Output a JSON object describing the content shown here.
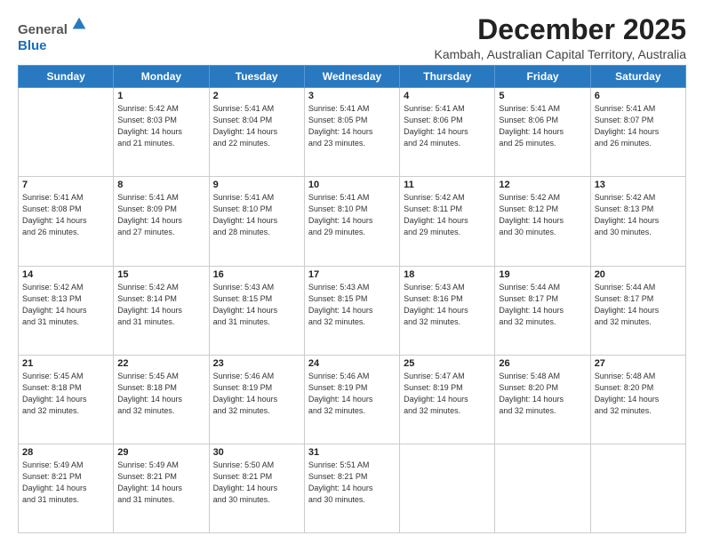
{
  "header": {
    "logo_line1": "General",
    "logo_line2": "Blue",
    "month_title": "December 2025",
    "location": "Kambah, Australian Capital Territory, Australia"
  },
  "days": [
    "Sunday",
    "Monday",
    "Tuesday",
    "Wednesday",
    "Thursday",
    "Friday",
    "Saturday"
  ],
  "weeks": [
    [
      {
        "day": "",
        "empty": true
      },
      {
        "day": "1",
        "sunrise": "5:42 AM",
        "sunset": "8:03 PM",
        "daylight": "14 hours and 21 minutes."
      },
      {
        "day": "2",
        "sunrise": "5:41 AM",
        "sunset": "8:04 PM",
        "daylight": "14 hours and 22 minutes."
      },
      {
        "day": "3",
        "sunrise": "5:41 AM",
        "sunset": "8:05 PM",
        "daylight": "14 hours and 23 minutes."
      },
      {
        "day": "4",
        "sunrise": "5:41 AM",
        "sunset": "8:06 PM",
        "daylight": "14 hours and 24 minutes."
      },
      {
        "day": "5",
        "sunrise": "5:41 AM",
        "sunset": "8:06 PM",
        "daylight": "14 hours and 25 minutes."
      },
      {
        "day": "6",
        "sunrise": "5:41 AM",
        "sunset": "8:07 PM",
        "daylight": "14 hours and 26 minutes."
      }
    ],
    [
      {
        "day": "7",
        "sunrise": "5:41 AM",
        "sunset": "8:08 PM",
        "daylight": "14 hours and 26 minutes."
      },
      {
        "day": "8",
        "sunrise": "5:41 AM",
        "sunset": "8:09 PM",
        "daylight": "14 hours and 27 minutes."
      },
      {
        "day": "9",
        "sunrise": "5:41 AM",
        "sunset": "8:10 PM",
        "daylight": "14 hours and 28 minutes."
      },
      {
        "day": "10",
        "sunrise": "5:41 AM",
        "sunset": "8:10 PM",
        "daylight": "14 hours and 29 minutes."
      },
      {
        "day": "11",
        "sunrise": "5:42 AM",
        "sunset": "8:11 PM",
        "daylight": "14 hours and 29 minutes."
      },
      {
        "day": "12",
        "sunrise": "5:42 AM",
        "sunset": "8:12 PM",
        "daylight": "14 hours and 30 minutes."
      },
      {
        "day": "13",
        "sunrise": "5:42 AM",
        "sunset": "8:13 PM",
        "daylight": "14 hours and 30 minutes."
      }
    ],
    [
      {
        "day": "14",
        "sunrise": "5:42 AM",
        "sunset": "8:13 PM",
        "daylight": "14 hours and 31 minutes."
      },
      {
        "day": "15",
        "sunrise": "5:42 AM",
        "sunset": "8:14 PM",
        "daylight": "14 hours and 31 minutes."
      },
      {
        "day": "16",
        "sunrise": "5:43 AM",
        "sunset": "8:15 PM",
        "daylight": "14 hours and 31 minutes."
      },
      {
        "day": "17",
        "sunrise": "5:43 AM",
        "sunset": "8:15 PM",
        "daylight": "14 hours and 32 minutes."
      },
      {
        "day": "18",
        "sunrise": "5:43 AM",
        "sunset": "8:16 PM",
        "daylight": "14 hours and 32 minutes."
      },
      {
        "day": "19",
        "sunrise": "5:44 AM",
        "sunset": "8:17 PM",
        "daylight": "14 hours and 32 minutes."
      },
      {
        "day": "20",
        "sunrise": "5:44 AM",
        "sunset": "8:17 PM",
        "daylight": "14 hours and 32 minutes."
      }
    ],
    [
      {
        "day": "21",
        "sunrise": "5:45 AM",
        "sunset": "8:18 PM",
        "daylight": "14 hours and 32 minutes."
      },
      {
        "day": "22",
        "sunrise": "5:45 AM",
        "sunset": "8:18 PM",
        "daylight": "14 hours and 32 minutes."
      },
      {
        "day": "23",
        "sunrise": "5:46 AM",
        "sunset": "8:19 PM",
        "daylight": "14 hours and 32 minutes."
      },
      {
        "day": "24",
        "sunrise": "5:46 AM",
        "sunset": "8:19 PM",
        "daylight": "14 hours and 32 minutes."
      },
      {
        "day": "25",
        "sunrise": "5:47 AM",
        "sunset": "8:19 PM",
        "daylight": "14 hours and 32 minutes."
      },
      {
        "day": "26",
        "sunrise": "5:48 AM",
        "sunset": "8:20 PM",
        "daylight": "14 hours and 32 minutes."
      },
      {
        "day": "27",
        "sunrise": "5:48 AM",
        "sunset": "8:20 PM",
        "daylight": "14 hours and 32 minutes."
      }
    ],
    [
      {
        "day": "28",
        "sunrise": "5:49 AM",
        "sunset": "8:21 PM",
        "daylight": "14 hours and 31 minutes."
      },
      {
        "day": "29",
        "sunrise": "5:49 AM",
        "sunset": "8:21 PM",
        "daylight": "14 hours and 31 minutes."
      },
      {
        "day": "30",
        "sunrise": "5:50 AM",
        "sunset": "8:21 PM",
        "daylight": "14 hours and 30 minutes."
      },
      {
        "day": "31",
        "sunrise": "5:51 AM",
        "sunset": "8:21 PM",
        "daylight": "14 hours and 30 minutes."
      },
      {
        "day": "",
        "empty": true
      },
      {
        "day": "",
        "empty": true
      },
      {
        "day": "",
        "empty": true
      }
    ]
  ]
}
